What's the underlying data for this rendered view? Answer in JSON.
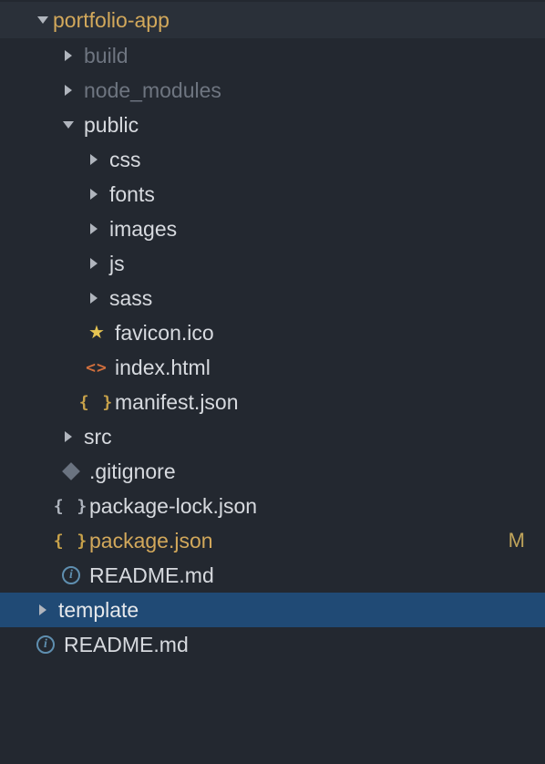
{
  "tree": {
    "root": {
      "name": "portfolio-app",
      "status": "dot"
    },
    "items": [
      {
        "name": "build",
        "kind": "folder",
        "indent": 1,
        "dim": true,
        "arrow": "right"
      },
      {
        "name": "node_modules",
        "kind": "folder",
        "indent": 1,
        "dim": true,
        "arrow": "right"
      },
      {
        "name": "public",
        "kind": "folder",
        "indent": 1,
        "dim": false,
        "arrow": "down"
      },
      {
        "name": "css",
        "kind": "folder",
        "indent": 2,
        "dim": false,
        "arrow": "right"
      },
      {
        "name": "fonts",
        "kind": "folder",
        "indent": 2,
        "dim": false,
        "arrow": "right"
      },
      {
        "name": "images",
        "kind": "folder",
        "indent": 2,
        "dim": false,
        "arrow": "right"
      },
      {
        "name": "js",
        "kind": "folder",
        "indent": 2,
        "dim": false,
        "arrow": "right"
      },
      {
        "name": "sass",
        "kind": "folder",
        "indent": 2,
        "dim": false,
        "arrow": "right"
      },
      {
        "name": "favicon.ico",
        "kind": "file",
        "indent": 2,
        "icon": "star"
      },
      {
        "name": "index.html",
        "kind": "file",
        "indent": 2,
        "icon": "angles"
      },
      {
        "name": "manifest.json",
        "kind": "file",
        "indent": 2,
        "icon": "braces-y"
      },
      {
        "name": "src",
        "kind": "folder",
        "indent": 1,
        "dim": false,
        "arrow": "right"
      },
      {
        "name": ".gitignore",
        "kind": "file",
        "indent": 1,
        "icon": "diamond"
      },
      {
        "name": "package-lock.json",
        "kind": "file",
        "indent": 1,
        "icon": "braces-w"
      },
      {
        "name": "package.json",
        "kind": "file",
        "indent": 1,
        "icon": "braces-y",
        "accent": true,
        "status": "M"
      },
      {
        "name": "README.md",
        "kind": "file",
        "indent": 1,
        "icon": "info"
      },
      {
        "name": "template",
        "kind": "folder",
        "indent": 0,
        "arrow": "right",
        "selected": true,
        "status": "dot"
      },
      {
        "name": "README.md",
        "kind": "file",
        "indent": 0,
        "icon": "info"
      }
    ]
  },
  "colors": {
    "bg": "#232830",
    "headerBg": "#2a3039",
    "selectedBg": "#204a75",
    "text": "#a4abb5",
    "dim": "#6e7580",
    "accent": "#d2a85b"
  }
}
